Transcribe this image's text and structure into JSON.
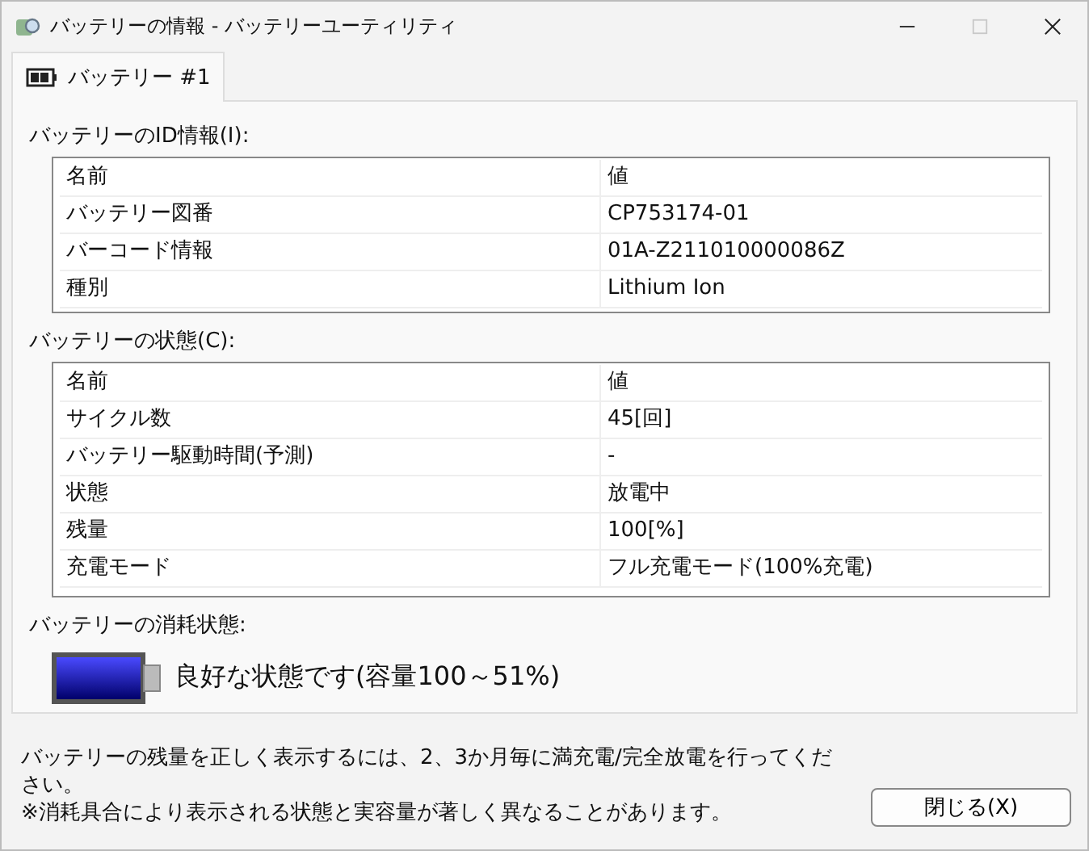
{
  "window": {
    "title": "バッテリーの情報 - バッテリーユーティリティ",
    "controls": [
      {
        "kind": "minimize",
        "disabled": false
      },
      {
        "kind": "maximize",
        "disabled": true
      },
      {
        "kind": "close",
        "disabled": false
      }
    ]
  },
  "tabs": [
    {
      "label": "バッテリー #1",
      "selected": true
    }
  ],
  "sections": [
    {
      "label": "バッテリーのID情報(I):",
      "columns": [
        "名前",
        "値"
      ],
      "rows": [
        [
          "バッテリー図番",
          "CP753174-01"
        ],
        [
          "バーコード情報",
          "01A-Z211010000086Z"
        ],
        [
          "種別",
          "Lithium Ion"
        ]
      ]
    },
    {
      "label": "バッテリーの状態(C):",
      "columns": [
        "名前",
        "値"
      ],
      "rows": [
        [
          "サイクル数",
          "45[回]"
        ],
        [
          "バッテリー駆動時間(予測)",
          "-"
        ],
        [
          "状態",
          "放電中"
        ],
        [
          "残量",
          "100[%]"
        ],
        [
          "充電モード",
          "フル充電モード(100%充電)"
        ]
      ]
    }
  ],
  "health": {
    "label": "バッテリーの消耗状態:",
    "level": 1,
    "text": "良好な状態です(容量100～51%)"
  },
  "notes": [
    "バッテリーの残量を正しく表示するには、2、3か月毎に満充電/完全放電を行ってください。",
    "※消耗具合により表示される状態と実容量が著しく異なることがあります。"
  ],
  "buttons": [
    {
      "label": "閉じる(X)"
    }
  ]
}
